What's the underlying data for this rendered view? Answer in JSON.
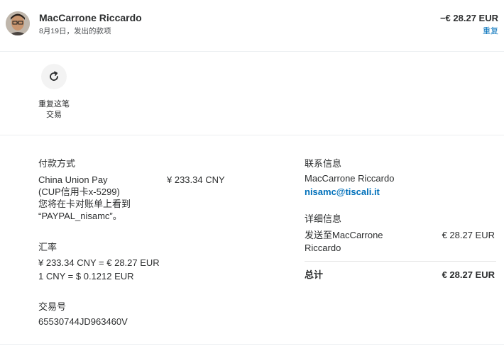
{
  "header": {
    "name": "MacCarrone Riccardo",
    "date_line": "8月19日，发出的款项",
    "amount": "−€ 28.27 EUR",
    "status": "重复"
  },
  "actions": {
    "repeat_label": "重复这笔\n交易",
    "repeat_icon": "refresh-icon"
  },
  "payment": {
    "heading": "付款方式",
    "method_lines": "China Union Pay\n(CUP信用卡x-5299)\n您将在卡对账单上看到\n“PAYPAL_nisamc”。",
    "amount": "¥ 233.34 CNY"
  },
  "exchange": {
    "heading": "汇率",
    "lines": "¥ 233.34 CNY = € 28.27 EUR\n1 CNY = $ 0.1212 EUR"
  },
  "transaction": {
    "heading": "交易号",
    "id": "65530744JD963460V"
  },
  "contact": {
    "heading": "联系信息",
    "name": "MacCarrone Riccardo",
    "email": "nisamc@tiscali.it"
  },
  "details": {
    "heading": "详细信息",
    "ship_to": "发送至MacCarrone\nRiccardo",
    "ship_amount": "€ 28.27 EUR",
    "total_label": "总计",
    "total_amount": "€ 28.27 EUR"
  },
  "colors": {
    "link": "#0070ba",
    "text": "#2c2e2f",
    "divider": "#eceff1"
  }
}
